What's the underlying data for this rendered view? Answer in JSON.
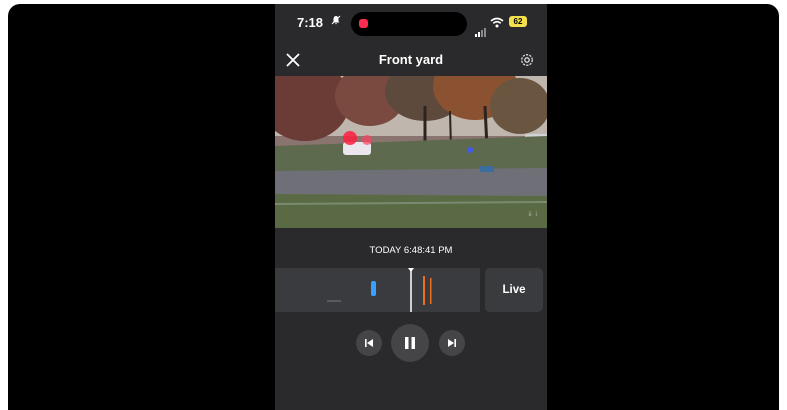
{
  "status_bar": {
    "time": "7:18",
    "battery": "62",
    "alarm_icon": "bell-icon"
  },
  "header": {
    "title": "Front yard",
    "close_icon": "close-icon",
    "settings_icon": "gear-icon"
  },
  "player": {
    "timestamp": "TODAY 6:48:41 PM",
    "live_label": "Live"
  },
  "controls": {
    "previous_icon": "skip-previous-icon",
    "pause_icon": "pause-icon",
    "next_icon": "skip-next-icon"
  },
  "colors": {
    "accent_blue": "#3aa0ff",
    "event_orange": "#e8701f",
    "recording_red": "#ff2d4f",
    "battery": "#f4e04d"
  }
}
